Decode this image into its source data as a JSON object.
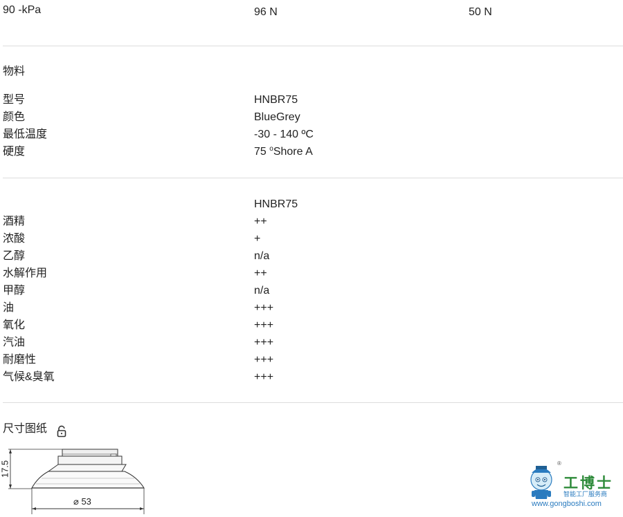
{
  "pressure_row": {
    "label": "90 -kPa",
    "value_a": "96 N",
    "value_b": "50 N"
  },
  "material": {
    "heading": "物料",
    "rows": [
      {
        "label": "型号",
        "value": "HNBR75"
      },
      {
        "label": "颜色",
        "value": "BlueGrey"
      },
      {
        "label": "最低温度",
        "value": "-30 - 140 ºC"
      },
      {
        "label": "硬度",
        "value_main": "75 ",
        "value_sup": "o",
        "value_rest": "Shore A"
      }
    ]
  },
  "resistance": {
    "column_header": "HNBR75",
    "rows": [
      {
        "label": "酒精",
        "value": "++"
      },
      {
        "label": "浓酸",
        "value": "+"
      },
      {
        "label": "乙醇",
        "value": "n/a"
      },
      {
        "label": "水解作用",
        "value": "++"
      },
      {
        "label": "甲醇",
        "value": "n/a"
      },
      {
        "label": "油",
        "value": "+++"
      },
      {
        "label": "氧化",
        "value": "+++"
      },
      {
        "label": "汽油",
        "value": "+++"
      },
      {
        "label": "耐磨性",
        "value": "+++"
      },
      {
        "label": "气候&臭氧",
        "value": "+++"
      }
    ]
  },
  "dimensions": {
    "heading": "尺寸图纸",
    "lock_icon": "unlock-icon",
    "height_label": "17.5",
    "diameter_label": "⌀ 53"
  },
  "watermark": {
    "name": "工博士",
    "tagline": "智能工厂服务商",
    "url": "www.gongboshi.com",
    "registered": "®"
  },
  "colors": {
    "text": "#222222",
    "divider": "#dcdcdc",
    "logo_blue": "#2a7bbf",
    "logo_green": "#2e8b3a"
  }
}
